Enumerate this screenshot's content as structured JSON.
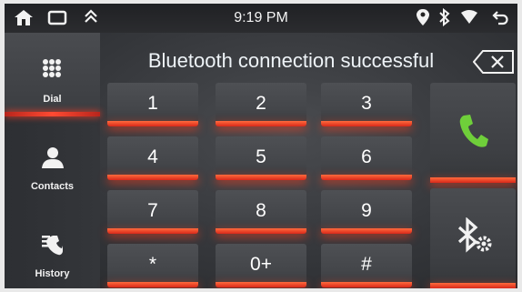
{
  "status_bar": {
    "time": "9:19 PM",
    "left_icons": [
      "home-icon",
      "recent-apps-icon",
      "collapse-icon"
    ],
    "right_icons": [
      "location-icon",
      "bluetooth-icon",
      "wifi-icon",
      "back-icon"
    ]
  },
  "sidebar": {
    "items": [
      {
        "label": "Dial",
        "icon": "dialpad-icon",
        "active": true
      },
      {
        "label": "Contacts",
        "icon": "person-icon",
        "active": false
      },
      {
        "label": "History",
        "icon": "call-history-icon",
        "active": false
      }
    ]
  },
  "header": {
    "message": "Bluetooth connection successful",
    "backspace_icon": "backspace-icon"
  },
  "keypad": {
    "keys": [
      "1",
      "2",
      "3",
      "4",
      "5",
      "6",
      "7",
      "8",
      "9",
      "*",
      "0+",
      "#"
    ]
  },
  "actions": {
    "call_icon": "phone-icon",
    "bluetooth_settings_icon": "bluetooth-settings-icon"
  },
  "colors": {
    "accent_red": "#ff3b25",
    "call_green": "#6fcf3a"
  }
}
